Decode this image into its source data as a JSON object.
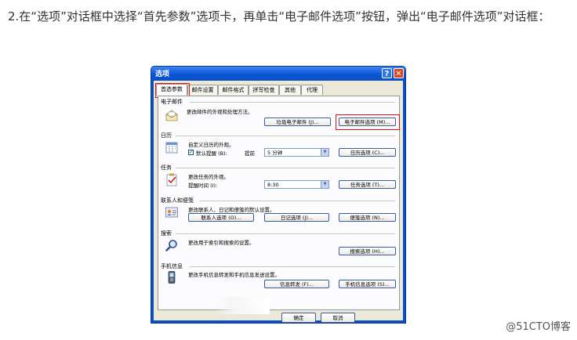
{
  "intro": "2.在“选项”对话框中选择“首先参数”选项卡，再单击“电子邮件选项”按钮，弹出“电子邮件选项”对话框：",
  "dialog": {
    "title": "选项",
    "help_glyph": "?",
    "close_glyph": "✕",
    "tabs": [
      "首选参数",
      "邮件设置",
      "邮件格式",
      "拼写检查",
      "其他",
      "代理"
    ],
    "sections": {
      "email": {
        "title": "电子邮件",
        "desc": "更改邮件的外观和处理方法。",
        "buttons": [
          "垃圾电子邮件 (J)...",
          "电子邮件选项 (M)..."
        ]
      },
      "calendar": {
        "title": "日历",
        "desc": "自定义日历的外观。",
        "checkbox_label": "默认提醒 (B):",
        "advance_label": "提前",
        "select_value": "5 分钟",
        "button": "日历选项 (C)..."
      },
      "tasks": {
        "title": "任务",
        "desc": "更改任务的外观。",
        "time_label": "提醒时间 (I):",
        "select_value": "8:30",
        "button": "任务选项 (T)..."
      },
      "contacts": {
        "title": "联系人和便笺",
        "desc": "更改联系人、日记和便笺的默认设置。",
        "buttons": [
          "联系人选项 (O)...",
          "日记选项 (J)...",
          "便笺选项 (N)..."
        ]
      },
      "search": {
        "title": "搜索",
        "desc": "更改用于索引和搜索的设置。",
        "button": "搜索选项 (H)..."
      },
      "mobile": {
        "title": "手机信息",
        "desc": "更改手机信息转发和手机信息发送设置。",
        "buttons": [
          "信息转发 (F)...",
          "手机信息选项 (S)..."
        ]
      }
    },
    "footer": {
      "ok": "确定",
      "cancel": "取消"
    }
  },
  "watermark": "@51CTO博客",
  "colors": {
    "highlight": "#e01010",
    "titlebar": "#0a4fc3"
  }
}
